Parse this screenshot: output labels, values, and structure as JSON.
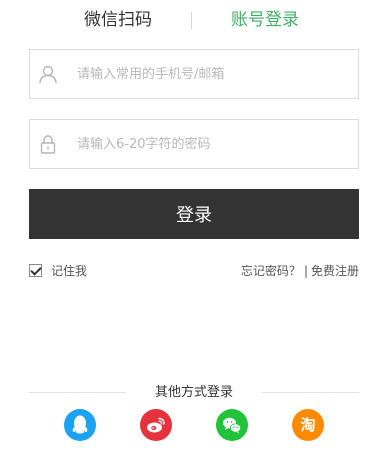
{
  "tabs": {
    "qr_login": "微信扫码",
    "account_login": "账号登录"
  },
  "form": {
    "username_placeholder": "请输入常用的手机号/邮箱",
    "password_placeholder": "请输入6-20字符的密码",
    "username_value": "",
    "password_value": "",
    "submit_label": "登录"
  },
  "options": {
    "remember_label": "记住我",
    "remember_checked": true,
    "forgot_label": "忘记密码？",
    "separator": "|",
    "register_label": "免费注册"
  },
  "other_login": {
    "title": "其他方式登录",
    "providers": [
      {
        "name": "qq-icon",
        "color": "#1aa3f2"
      },
      {
        "name": "weibo-icon",
        "color": "#e5323c"
      },
      {
        "name": "wechat-icon",
        "color": "#21c33b"
      },
      {
        "name": "taobao-icon",
        "color": "#ff8a00",
        "glyph": "淘"
      }
    ]
  },
  "colors": {
    "accent_green": "#3eaf64",
    "button_dark": "#333333"
  }
}
